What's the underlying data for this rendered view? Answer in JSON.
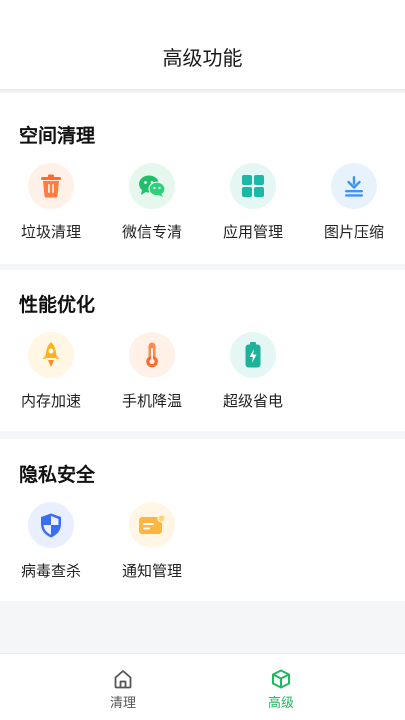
{
  "header": {
    "title": "高级功能"
  },
  "sections": [
    {
      "title": "空间清理",
      "items": [
        {
          "label": "垃圾清理",
          "icon": "trash-icon",
          "color": "#ff6a2b",
          "bg": "#fff0e8"
        },
        {
          "label": "微信专清",
          "icon": "wechat-icon",
          "color": "#1fc06a",
          "bg": "#e6f8ee"
        },
        {
          "label": "应用管理",
          "icon": "apps-grid-icon",
          "color": "#1bb8a5",
          "bg": "#e4f7f4"
        },
        {
          "label": "图片压缩",
          "icon": "download-compress-icon",
          "color": "#3a93f5",
          "bg": "#e8f2fd"
        }
      ]
    },
    {
      "title": "性能优化",
      "items": [
        {
          "label": "内存加速",
          "icon": "rocket-icon",
          "color": "#ffb21e",
          "bg": "#fff6e3"
        },
        {
          "label": "手机降温",
          "icon": "thermometer-icon",
          "color": "#ff7a3d",
          "bg": "#fff0e8"
        },
        {
          "label": "超级省电",
          "icon": "battery-icon",
          "color": "#1bb39a",
          "bg": "#e4f7f4"
        }
      ]
    },
    {
      "title": "隐私安全",
      "items": [
        {
          "label": "病毒查杀",
          "icon": "shield-icon",
          "color": "#3b6cf6",
          "bg": "#e9effe"
        },
        {
          "label": "通知管理",
          "icon": "notification-card-icon",
          "color": "#ffb640",
          "bg": "#fff6e6"
        }
      ]
    }
  ],
  "tabbar": {
    "tabs": [
      {
        "label": "清理",
        "icon": "home-icon",
        "active": false
      },
      {
        "label": "高级",
        "icon": "cube-icon",
        "active": true
      }
    ],
    "active_color": "#1fb960",
    "inactive_color": "#555555"
  }
}
